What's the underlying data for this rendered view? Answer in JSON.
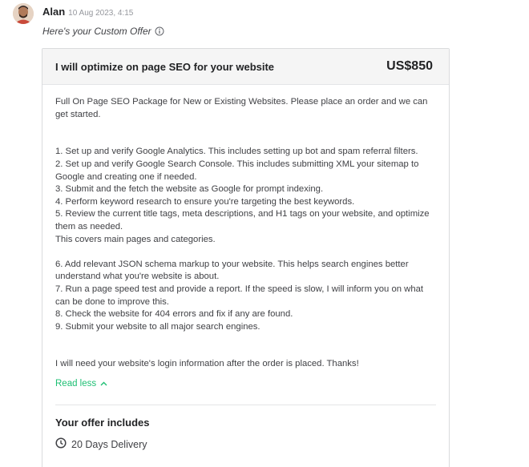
{
  "message": {
    "sender": "Alan",
    "timestamp": "10 Aug 2023, 4:15",
    "intro": "Here's your Custom Offer"
  },
  "offer": {
    "title": "I will optimize on page SEO for your website",
    "price": "US$850",
    "description": {
      "p1": "Full On Page SEO Package for New or Existing Websites. Please place an order and we can get started.",
      "item1": "1. Set up and verify Google Analytics. This includes setting up bot and spam referral filters.",
      "item2": "2. Set up and verify Google Search Console. This includes submitting XML your sitemap to Google and creating one if needed.",
      "item3": "3. Submit and the fetch the website as Google for prompt indexing.",
      "item4": "4. Perform keyword research to ensure you're targeting the best keywords.",
      "item5": "5. Review the current title tags, meta descriptions, and H1 tags on your website, and optimize them as needed.",
      "note": "This covers main pages and categories.",
      "item6": "6. Add relevant JSON schema markup to your website. This helps search engines better understand what you're website is about.",
      "item7": "7. Run a page speed test and provide a report. If the speed is slow, I will inform you on what can be done to improve this.",
      "item8": "8. Check the website for 404 errors and fix if any are found.",
      "item9": "9. Submit your website to all major search engines.",
      "closing": "I will need your website's login information after the order is placed. Thanks!"
    },
    "read_less_label": "Read less",
    "includes_title": "Your offer includes",
    "delivery": "20 Days Delivery"
  },
  "colors": {
    "accent": "#1dbf73",
    "border": "#dadbdd",
    "header_bg": "#f5f5f5"
  },
  "icons": {
    "info": "info-icon",
    "read_less": "chevron-up-icon",
    "delivery": "clock-icon"
  }
}
